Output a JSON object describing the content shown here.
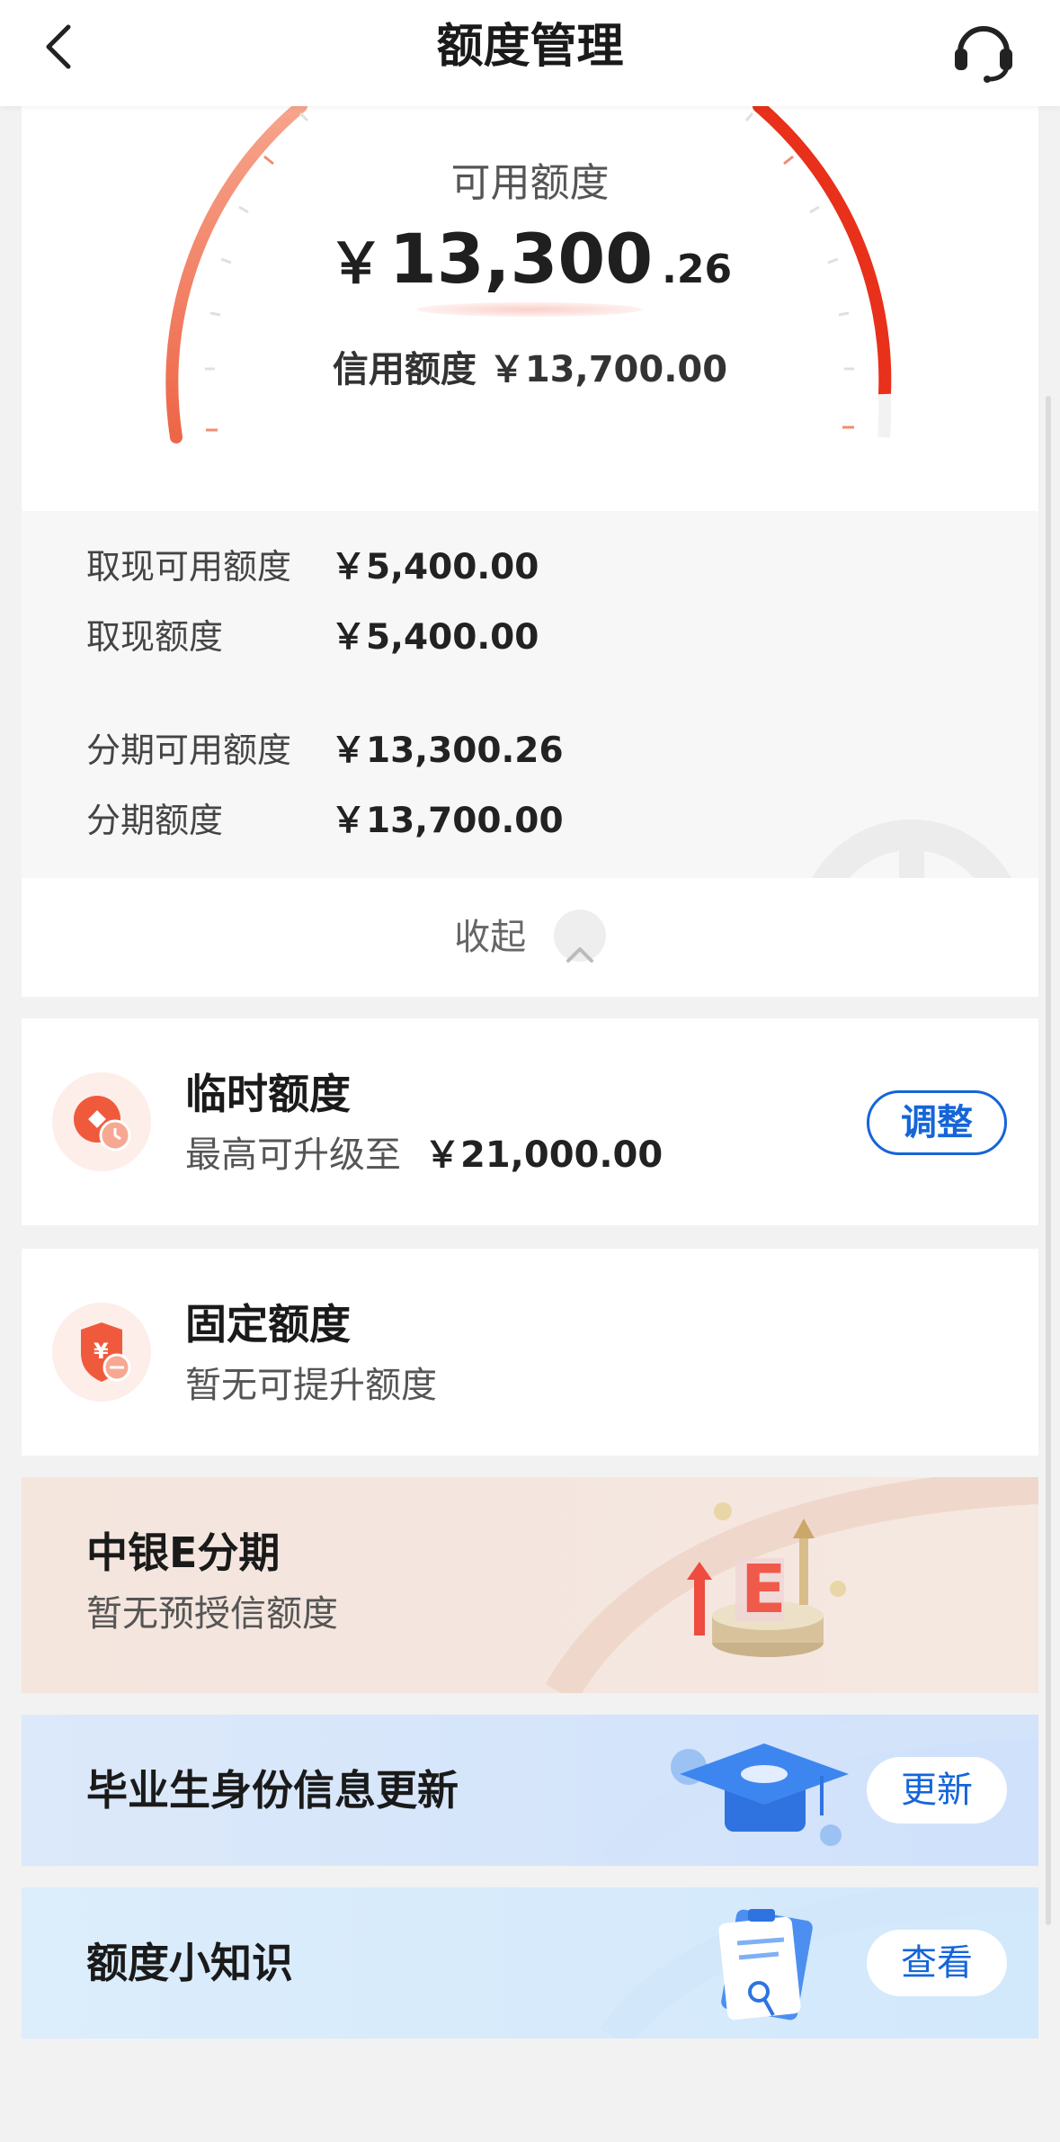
{
  "header": {
    "title": "额度管理",
    "back_icon": "chevron-left-icon",
    "service_icon": "headset-icon"
  },
  "summary": {
    "available_label": "可用额度",
    "available_currency": "￥",
    "available_integer": "13,300",
    "available_decimal": ".26",
    "credit_limit_text": "信用额度 ￥13,700.00",
    "gauge_colors": {
      "start": "#f28a6b",
      "end": "#e8301b"
    }
  },
  "details": [
    {
      "label": "取现可用额度",
      "value": "￥5,400.00"
    },
    {
      "label": "取现额度",
      "value": "￥5,400.00"
    },
    {
      "label": "分期可用额度",
      "value": "￥13,300.26"
    },
    {
      "label": "分期额度",
      "value": "￥13,700.00"
    }
  ],
  "collapse": {
    "label": "收起",
    "icon": "chevron-up-icon"
  },
  "temporary": {
    "title": "临时额度",
    "subtitle": "最高可升级至",
    "amount": "￥21,000.00",
    "button": "调整",
    "icon": "coin-clock-icon"
  },
  "fixed": {
    "title": "固定额度",
    "subtitle": "暂无可提升额度",
    "icon": "shield-yuan-icon"
  },
  "installment": {
    "title": "中银E分期",
    "subtitle": "暂无预授信额度",
    "icon": "e-installment-illustration"
  },
  "graduate": {
    "title": "毕业生身份信息更新",
    "button": "更新",
    "icon": "graduation-cap-illustration"
  },
  "knowledge": {
    "title": "额度小知识",
    "button": "查看",
    "icon": "clipboard-illustration"
  },
  "colors": {
    "accent_blue": "#1565d8",
    "accent_red": "#e8301b"
  }
}
